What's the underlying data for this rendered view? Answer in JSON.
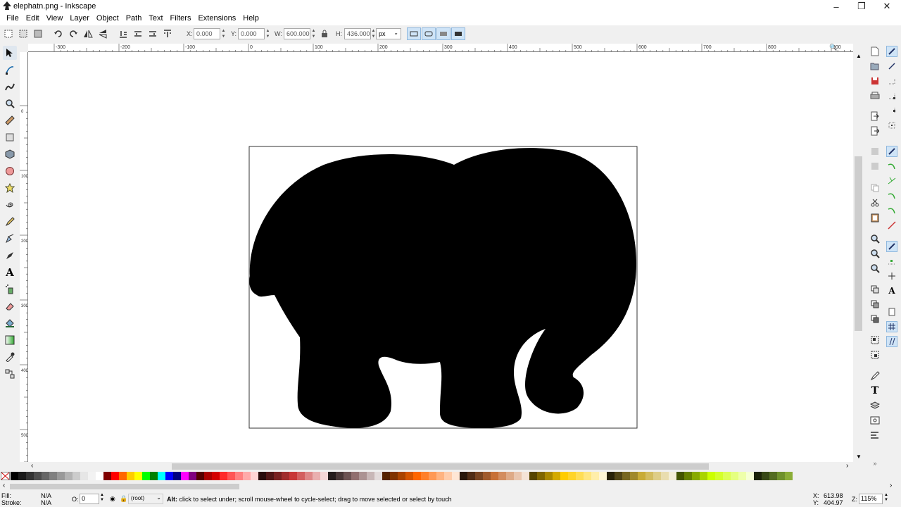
{
  "window": {
    "title": "elephatn.png - Inkscape",
    "controls": [
      "minimize",
      "maximize",
      "close"
    ]
  },
  "menu": [
    "File",
    "Edit",
    "View",
    "Layer",
    "Object",
    "Path",
    "Text",
    "Filters",
    "Extensions",
    "Help"
  ],
  "toolbar": {
    "x_label": "X:",
    "x_value": "0.000",
    "y_label": "Y:",
    "y_value": "0.000",
    "w_label": "W:",
    "w_value": "600.000",
    "h_label": "H:",
    "h_value": "436.000",
    "unit": "px"
  },
  "tools": [
    "selector-tool",
    "node-tool",
    "tweak-tool",
    "zoom-tool",
    "measure-tool",
    "rectangle-tool",
    "3d-box-tool",
    "ellipse-tool",
    "star-tool",
    "spiral-tool",
    "pencil-tool",
    "pen-tool",
    "calligraphy-tool",
    "text-tool",
    "spray-tool",
    "eraser-tool",
    "paint-bucket-tool",
    "gradient-tool",
    "dropper-tool",
    "connector-tool"
  ],
  "ruler": {
    "h_labels": [
      "-300",
      "-200",
      "-100",
      "0",
      "100",
      "200",
      "300",
      "400",
      "500",
      "600",
      "700",
      "800",
      "900"
    ],
    "v_labels": [
      "0",
      "100",
      "200",
      "300",
      "400",
      "500"
    ]
  },
  "document": {
    "image_name": "elephant-silhouette",
    "fill": "#000000",
    "background": "#ffffff"
  },
  "palette": [
    "#000000",
    "#1a1a1a",
    "#333333",
    "#4d4d4d",
    "#666666",
    "#808080",
    "#999999",
    "#b3b3b3",
    "#cccccc",
    "#e6e6e6",
    "#f2f2f2",
    "#ffffff",
    "#800000",
    "#ff0000",
    "#ff6600",
    "#ffcc00",
    "#ffff00",
    "#00ff00",
    "#008000",
    "#00ffff",
    "#0000ff",
    "#000080",
    "#ff00ff",
    "#800080",
    "#550000",
    "#aa0000",
    "#d40000",
    "#ff2a2a",
    "#ff5555",
    "#ff8080",
    "#ffaaaa",
    "#ffd5d5",
    "#280b0b",
    "#501616",
    "#782121",
    "#a02c2c",
    "#c83737",
    "#d35f5f",
    "#de8787",
    "#e9afaf",
    "#f4d7d7",
    "#241c1c",
    "#483737",
    "#6c5353",
    "#916f6f",
    "#ac9393",
    "#c8b7b7",
    "#e3dbdb",
    "#552200",
    "#803300",
    "#aa4400",
    "#d45500",
    "#ff6600",
    "#ff7f2a",
    "#ff9955",
    "#ffb380",
    "#ffccaa",
    "#ffe6d5",
    "#28170b",
    "#502d16",
    "#784421",
    "#a05a2c",
    "#c87137",
    "#d38d5f",
    "#deaa87",
    "#e9c6af",
    "#f4e3d7",
    "#554400",
    "#806600",
    "#aa8800",
    "#d4aa00",
    "#ffcc00",
    "#ffd42a",
    "#ffdd55",
    "#ffe680",
    "#ffeeaa",
    "#fff6d5",
    "#282208",
    "#504416",
    "#786721",
    "#a0892c",
    "#c8ab37",
    "#d3bc5f",
    "#decd87",
    "#e9ddaf",
    "#f4eed7",
    "#445500",
    "#668000",
    "#88aa00",
    "#aad400",
    "#ccff00",
    "#d4ff2a",
    "#ddff55",
    "#e5ff80",
    "#eeffaa",
    "#f6ffd5",
    "#1c2408",
    "#374816",
    "#536c21",
    "#6f912c",
    "#8bad37"
  ],
  "status": {
    "fill_label": "Fill:",
    "fill_value": "N/A",
    "stroke_label": "Stroke:",
    "stroke_value": "N/A",
    "opacity_label": "O:",
    "opacity_value": "0",
    "layer": "(root)",
    "message_bold": "Alt:",
    "message": " click to select under; scroll mouse-wheel to cycle-select; drag to move selected or select by touch",
    "x_label": "X:",
    "x_value": "613.98",
    "y_label": "Y:",
    "y_value": "404.97",
    "zoom_label": "Z:",
    "zoom_value": "115%"
  }
}
